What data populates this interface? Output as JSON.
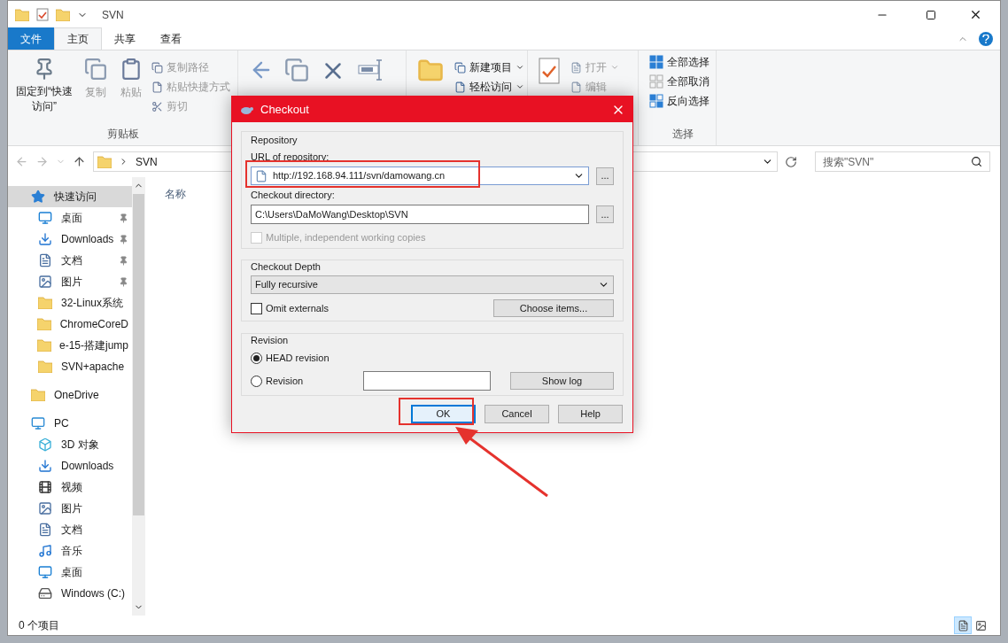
{
  "window": {
    "title": "SVN"
  },
  "ribbon_tabs": [
    {
      "label": "文件",
      "kind": "file",
      "selected": false
    },
    {
      "label": "主页",
      "kind": "tab",
      "selected": true
    },
    {
      "label": "共享",
      "kind": "tab",
      "selected": false
    },
    {
      "label": "查看",
      "kind": "tab",
      "selected": false
    }
  ],
  "clipboard_group": {
    "pin": "固定到“快速访问”",
    "copy": "复制",
    "paste": "粘贴",
    "copy_path": "复制路径",
    "paste_shortcut": "粘贴快捷方式",
    "cut": "剪切",
    "label": "剪贴板"
  },
  "new_group": {
    "new_item": "新建项目",
    "easy_access": "轻松访问"
  },
  "open_group": {
    "open": "打开",
    "edit": "编辑"
  },
  "select_group": {
    "select_all": "全部选择",
    "select_none": "全部取消",
    "invert": "反向选择",
    "label": "选择"
  },
  "address": {
    "path": "SVN",
    "search_placeholder": "搜索\"SVN\""
  },
  "column_header": "名称",
  "nav": [
    {
      "label": "快速访问",
      "kind": "star",
      "selected": true,
      "children": [
        {
          "label": "桌面",
          "kind": "desktop",
          "pinned": true,
          "selected": false
        },
        {
          "label": "Downloads",
          "kind": "download",
          "pinned": true,
          "selected": false
        },
        {
          "label": "文档",
          "kind": "document",
          "pinned": true,
          "selected": false
        },
        {
          "label": "图片",
          "kind": "image",
          "pinned": true,
          "selected": false
        },
        {
          "label": "32-Linux系统",
          "kind": "folder",
          "pinned": false,
          "selected": false
        },
        {
          "label": "ChromeCoreD",
          "kind": "folder",
          "pinned": false,
          "selected": false
        },
        {
          "label": "e-15-搭建jump",
          "kind": "folder",
          "pinned": false,
          "selected": false
        },
        {
          "label": "SVN+apache",
          "kind": "folder",
          "pinned": false,
          "selected": false
        }
      ]
    },
    {
      "label": "OneDrive",
      "kind": "folder",
      "selected": false
    },
    {
      "label": "PC",
      "kind": "pc",
      "selected": false,
      "children": [
        {
          "label": "3D 对象",
          "kind": "cube",
          "pinned": false,
          "selected": false
        },
        {
          "label": "Downloads",
          "kind": "download",
          "pinned": false,
          "selected": false
        },
        {
          "label": "视频",
          "kind": "video",
          "pinned": false,
          "selected": false
        },
        {
          "label": "图片",
          "kind": "image",
          "pinned": false,
          "selected": false
        },
        {
          "label": "文档",
          "kind": "document",
          "pinned": false,
          "selected": false
        },
        {
          "label": "音乐",
          "kind": "music",
          "pinned": false,
          "selected": false
        },
        {
          "label": "桌面",
          "kind": "desktop",
          "pinned": false,
          "selected": false
        },
        {
          "label": "Windows (C:)",
          "kind": "drive",
          "pinned": false,
          "selected": false
        }
      ]
    }
  ],
  "status_bar": {
    "count": "0 个项目",
    "views": [
      {
        "kind": "details",
        "selected": true
      },
      {
        "kind": "thumbnails",
        "selected": false
      }
    ]
  },
  "dialog": {
    "title": "Checkout",
    "repository": {
      "legend": "Repository",
      "url_label": "URL of repository:",
      "url": "http://192.168.94.111/svn/damowang.cn",
      "browse": "...",
      "dir_label": "Checkout directory:",
      "dir": "C:\\Users\\DaMoWang\\Desktop\\SVN",
      "dir_browse": "...",
      "multiple": {
        "label": "Multiple, independent working copies",
        "checked": false,
        "disabled": true
      }
    },
    "depth": {
      "legend": "Checkout Depth",
      "value": "Fully recursive",
      "omit": {
        "label": "Omit externals",
        "checked": false,
        "disabled": false
      },
      "choose": "Choose items..."
    },
    "revision": {
      "legend": "Revision",
      "options": [
        {
          "label": "HEAD revision",
          "selected": true
        },
        {
          "label": "Revision",
          "selected": false
        }
      ],
      "show_log": "Show log"
    },
    "buttons": [
      {
        "label": "OK",
        "default": true
      },
      {
        "label": "Cancel",
        "default": false
      },
      {
        "label": "Help",
        "default": false
      }
    ]
  }
}
